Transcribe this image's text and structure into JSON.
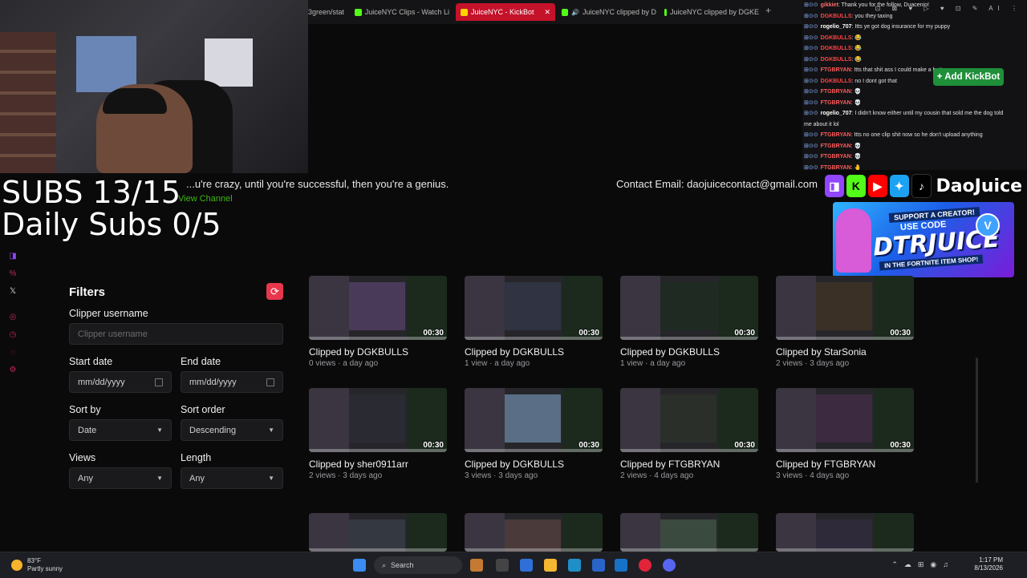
{
  "browser": {
    "tabs": [
      {
        "label": "3green/stat"
      },
      {
        "label": "JuiceNYC Clips - Watch Li"
      },
      {
        "label": "JuiceNYC - KickBot",
        "active": true
      },
      {
        "label": "JuiceNYC clipped by D"
      },
      {
        "label": "JuiceNYC clipped by DGKE"
      }
    ],
    "new_tab_label": "+",
    "close_label": "✕"
  },
  "overlay": {
    "subs": "SUBS 13/15",
    "daily_subs": "Daily Subs  0/5",
    "motto": "...u're crazy, until you're successful, then you're a genius.",
    "view_channel": "View Channel",
    "contact": "Contact Email: daojuicecontact@gmail.com",
    "brand": "DaoJuice",
    "promo": {
      "line1": "SUPPORT A CREATOR!",
      "line2": "USE CODE",
      "line3": "DTRJUICE",
      "line4": "IN THE FORTNITE ITEM SHOP!",
      "badge": "V"
    }
  },
  "chat": {
    "messages": [
      {
        "user": "gikkiet",
        "color": "#ff6b6b",
        "msg": ": Thank you for the follow, Duacenio!"
      },
      {
        "user": "DGKBULLS",
        "color": "#ff4444",
        "msg": ": you they taxing"
      },
      {
        "user": "rogelio_707",
        "color": "#ffffff",
        "msg": ": Itts ye got dog insurance for my puppy"
      },
      {
        "user": "DGKBULLS",
        "color": "#ff4444",
        "msg": ": 😂"
      },
      {
        "user": "DGKBULLS",
        "color": "#ff4444",
        "msg": ": 😂"
      },
      {
        "user": "DGKBULLS",
        "color": "#ff4444",
        "msg": ": 😂"
      },
      {
        "user": "FTGBRYAN",
        "color": "#ff5a5a",
        "msg": ": Itts that shit ass I could make a better one"
      },
      {
        "user": "DGKBULLS",
        "color": "#ff4444",
        "msg": ": no I dont got that"
      },
      {
        "user": "FTGBRYAN",
        "color": "#ff5a5a",
        "msg": ": 💀"
      },
      {
        "user": "FTGBRYAN",
        "color": "#ff5a5a",
        "msg": ": 💀"
      },
      {
        "user": "rogelio_707",
        "color": "#ffffff",
        "msg": ": I didn't know either until my cousin that sold me the dog told"
      },
      {
        "user": "",
        "color": "#ffffff",
        "msg": "me about it lol"
      },
      {
        "user": "FTGBRYAN",
        "color": "#ff5a5a",
        "msg": ": Itts no one clip shit now so he don't upload anything"
      },
      {
        "user": "FTGBRYAN",
        "color": "#ff5a5a",
        "msg": ": 💀"
      },
      {
        "user": "FTGBRYAN",
        "color": "#ff5a5a",
        "msg": ": 💀"
      },
      {
        "user": "FTGBRYAN",
        "color": "#ff5a5a",
        "msg": ": 🤚"
      }
    ],
    "badges": "⊞⊙⊙",
    "toolbar": "⊡ ⊠ ♥ ▷ ♥ ⊡ ✎ AI ⋮"
  },
  "kickbot": {
    "add_button": "+ Add KickBot"
  },
  "filters": {
    "title": "Filters",
    "reset_icon": "⟳",
    "clipper_label": "Clipper username",
    "clipper_placeholder": "Clipper username",
    "start_label": "Start date",
    "start_value": "mm/dd/yyyy",
    "end_label": "End date",
    "end_value": "mm/dd/yyyy",
    "sort_by_label": "Sort by",
    "sort_by_value": "Date",
    "sort_order_label": "Sort order",
    "sort_order_value": "Descending",
    "views_label": "Views",
    "views_value": "Any",
    "length_label": "Length",
    "length_value": "Any"
  },
  "clips": [
    {
      "duration": "00:30",
      "title": "Clipped by DGKBULLS",
      "meta": "0 views · a day ago"
    },
    {
      "duration": "00:30",
      "title": "Clipped by DGKBULLS",
      "meta": "1 view · a day ago"
    },
    {
      "duration": "00:30",
      "title": "Clipped by DGKBULLS",
      "meta": "1 view · a day ago"
    },
    {
      "duration": "00:30",
      "title": "Clipped by StarSonia",
      "meta": "2 views · 3 days ago"
    },
    {
      "duration": "00:30",
      "title": "Clipped by sher0911arr",
      "meta": "2 views · 3 days ago"
    },
    {
      "duration": "00:30",
      "title": "Clipped by DGKBULLS",
      "meta": "3 views · 3 days ago"
    },
    {
      "duration": "00:30",
      "title": "Clipped by FTGBRYAN",
      "meta": "2 views · 4 days ago"
    },
    {
      "duration": "00:30",
      "title": "Clipped by FTGBRYAN",
      "meta": "3 views · 4 days ago"
    },
    {
      "duration": "",
      "title": "",
      "meta": ""
    },
    {
      "duration": "",
      "title": "",
      "meta": ""
    },
    {
      "duration": "",
      "title": "",
      "meta": ""
    },
    {
      "duration": "",
      "title": "",
      "meta": ""
    }
  ],
  "taskbar": {
    "weather_temp": "83°F",
    "weather_desc": "Partly sunny",
    "search_label": "Search",
    "time": "1:17 PM",
    "date": "8/13/2026"
  },
  "colors": {
    "kick_green": "#53fc18",
    "accent_red": "#e8374c",
    "background": "#0a0a0b"
  }
}
